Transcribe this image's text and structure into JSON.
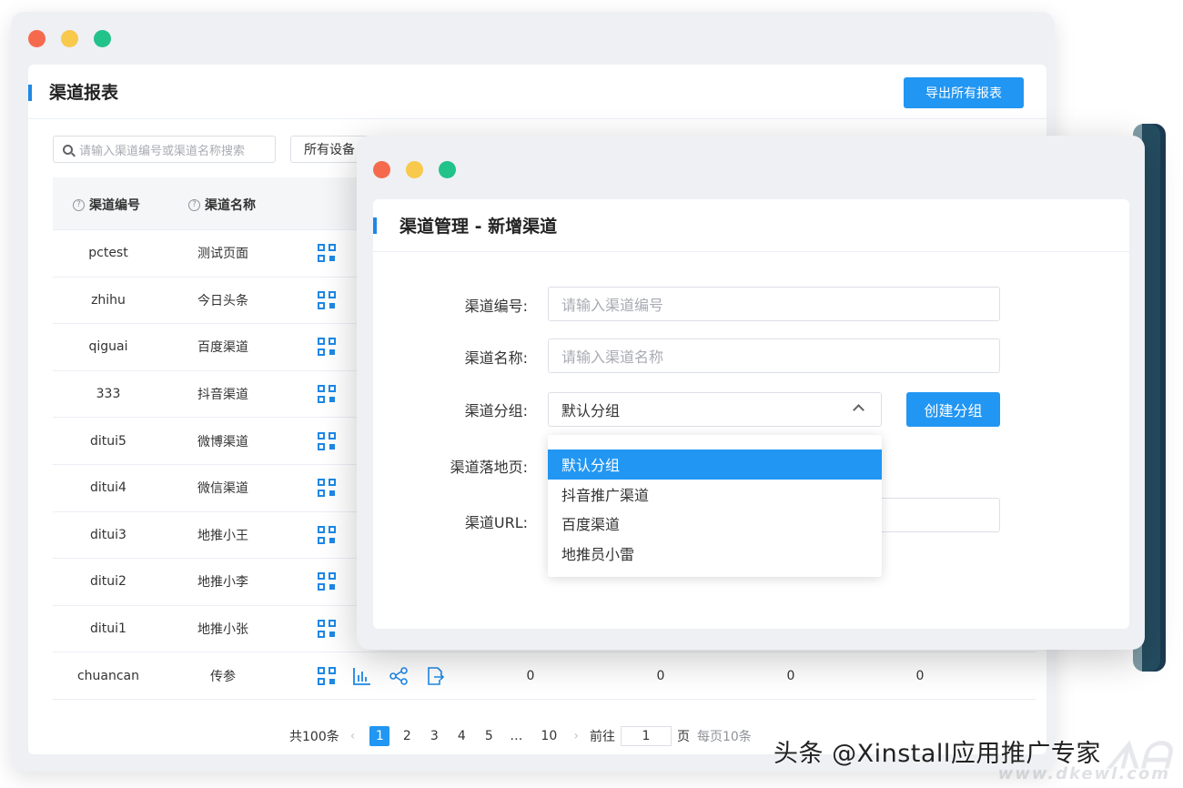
{
  "back_window": {
    "title": "渠道报表",
    "export_button": "导出所有报表",
    "search_placeholder": "请输入渠道编号或渠道名称搜索",
    "device_filter": "所有设备",
    "columns": [
      "渠道编号",
      "渠道名称"
    ],
    "rows": [
      {
        "id": "pctest",
        "name": "测试页面"
      },
      {
        "id": "zhihu",
        "name": "今日头条"
      },
      {
        "id": "qiguai",
        "name": "百度渠道"
      },
      {
        "id": "333",
        "name": "抖音渠道"
      },
      {
        "id": "ditui5",
        "name": "微博渠道"
      },
      {
        "id": "ditui4",
        "name": "微信渠道"
      },
      {
        "id": "ditui3",
        "name": "地推小王"
      },
      {
        "id": "ditui2",
        "name": "地推小李"
      },
      {
        "id": "ditui1",
        "name": "地推小张"
      },
      {
        "id": "chuancan",
        "name": "传参",
        "stats": [
          "0",
          "0",
          "0",
          "0"
        ]
      }
    ],
    "pagination": {
      "total": "共100条",
      "pages": [
        "1",
        "2",
        "3",
        "4",
        "5",
        "…",
        "10"
      ],
      "active_page": "1",
      "goto_label": "前往",
      "goto_value": "1",
      "page_unit": "页",
      "page_size": "每页10条"
    }
  },
  "front_window": {
    "title": "渠道管理 - 新增渠道",
    "fields": {
      "code_label": "渠道编号:",
      "code_placeholder": "请输入渠道编号",
      "name_label": "渠道名称:",
      "name_placeholder": "请输入渠道名称",
      "group_label": "渠道分组:",
      "group_value": "默认分组",
      "landing_label": "渠道落地页:",
      "url_label": "渠道URL:"
    },
    "create_group_button": "创建分组",
    "dropdown_options": [
      "默认分组",
      "抖音推广渠道",
      "百度渠道",
      "地推员小雷"
    ],
    "selected_option": "默认分组"
  },
  "watermark": {
    "text": "头条 @Xinstall应用推广专家",
    "logo": "ᗑᗩ",
    "sub": "www.dkewl.com"
  },
  "colors": {
    "accent": "#2196f3",
    "dot_red": "#f56a4c",
    "dot_yellow": "#f8c94b",
    "dot_green": "#22c28b"
  }
}
